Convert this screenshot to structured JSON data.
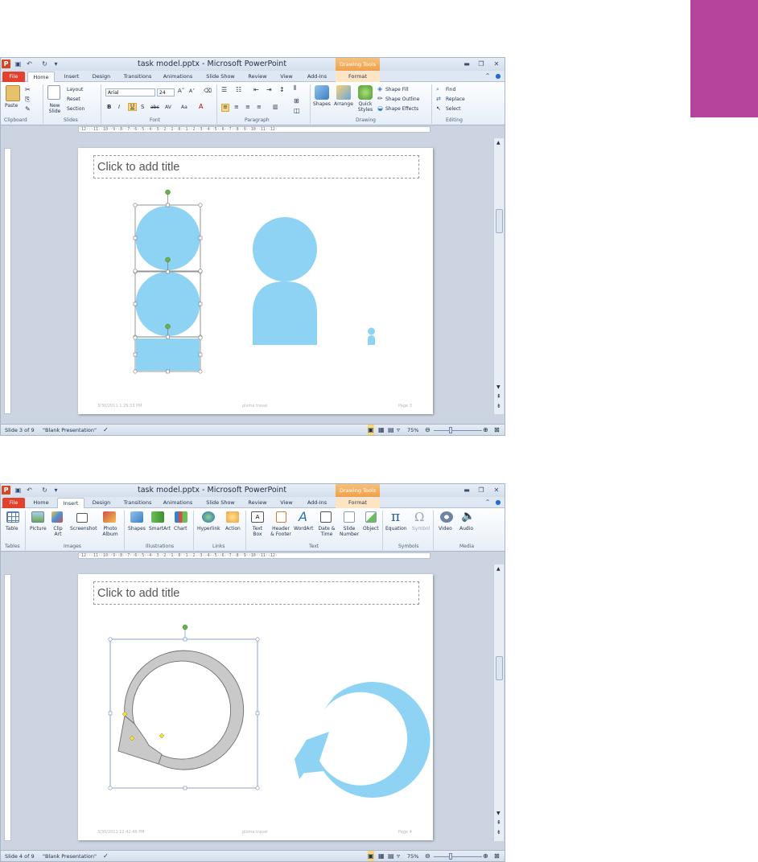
{
  "colors": {
    "accent": "#b5449c",
    "shape_fill": "#8fd3f4",
    "arrow_gray": "#c9c9c9",
    "ctx_orange": "#f0a04b"
  },
  "window": {
    "title": "task model.pptx - Microsoft PowerPoint",
    "app_icon": "P",
    "context_group": "Drawing Tools",
    "context_tab": "Format"
  },
  "tabs": [
    "File",
    "Home",
    "Insert",
    "Design",
    "Transitions",
    "Animations",
    "Slide Show",
    "Review",
    "View",
    "Add-Ins"
  ],
  "ribbon_home": {
    "paste": "Paste",
    "new_slide": "New Slide",
    "layout": "Layout",
    "reset": "Reset",
    "section": "Section",
    "font_name": "Arial",
    "font_size": "24",
    "shapes": "Shapes",
    "arrange": "Arrange",
    "quick_styles": "Quick Styles",
    "shape_fill": "Shape Fill",
    "shape_outline": "Shape Outline",
    "shape_effects": "Shape Effects",
    "find": "Find",
    "replace": "Replace",
    "select": "Select",
    "groups": [
      "Clipboard",
      "Slides",
      "Font",
      "Paragraph",
      "Drawing",
      "Editing"
    ]
  },
  "ribbon_insert": {
    "buttons": [
      "Table",
      "Picture",
      "Clip Art",
      "Screenshot",
      "Photo Album",
      "Shapes",
      "SmartArt",
      "Chart",
      "Hyperlink",
      "Action",
      "Text Box",
      "Header & Footer",
      "WordArt",
      "Date & Time",
      "Slide Number",
      "Object",
      "Equation",
      "Symbol",
      "Video",
      "Audio"
    ],
    "groups": [
      "Tables",
      "Images",
      "Illustrations",
      "Links",
      "Text",
      "Symbols",
      "Media"
    ]
  },
  "ruler_text": "·12···11··10··9··8··7··6··5··4··3··2··1··0··1··2··3··4··5··6··7··8··9··10··11··12·",
  "screen1": {
    "title_placeholder": "Click to add title",
    "footer_date": "3/30/2011 1:25:33 PM",
    "footer_center": "pixma travel",
    "footer_page": "Page 3",
    "status_slide": "Slide 3 of 9",
    "status_theme": "\"Blank Presentation\"",
    "zoom": "75%"
  },
  "screen2": {
    "title_placeholder": "Click to add title",
    "footer_date": "3/30/2011 12:42:46 PM",
    "footer_center": "pixma travel",
    "footer_page": "Page 4",
    "status_slide": "Slide 4 of 9",
    "status_theme": "\"Blank Presentation\"",
    "zoom": "75%"
  }
}
